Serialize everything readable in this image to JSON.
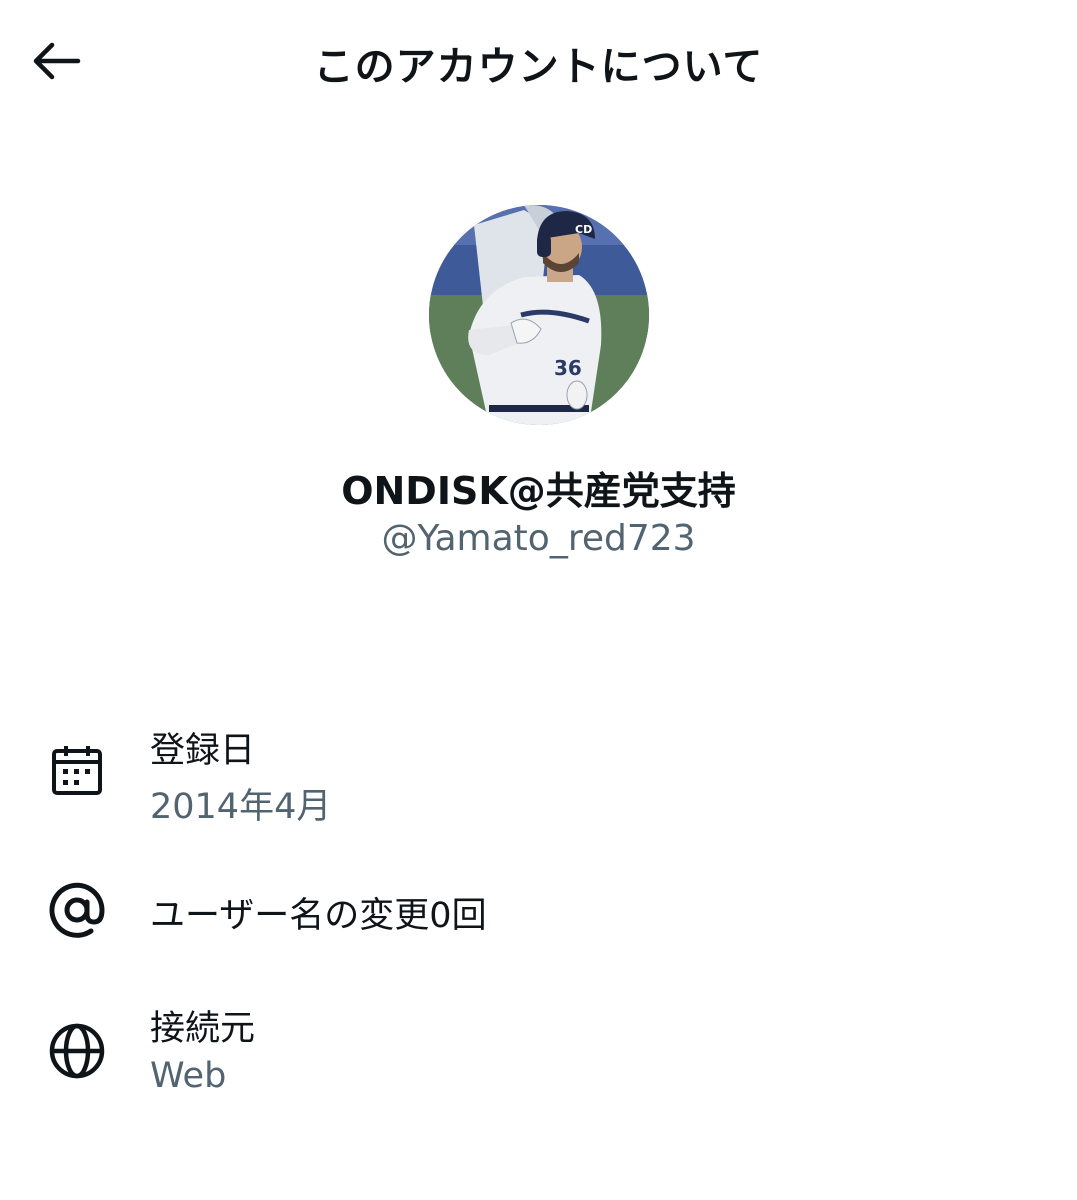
{
  "header": {
    "title": "このアカウントについて",
    "back_icon": "arrow-left-icon"
  },
  "profile": {
    "avatar_icon": "profile-photo",
    "display_name": "ONDISK@共産党支持",
    "handle": "@Yamato_red723"
  },
  "details": {
    "joined": {
      "icon": "calendar-icon",
      "label": "登録日",
      "value": "2014年4月"
    },
    "username_changes": {
      "icon": "at-sign-icon",
      "label": "ユーザー名の変更0回"
    },
    "connected_via": {
      "icon": "globe-icon",
      "label": "接続元",
      "value": "Web"
    }
  },
  "colors": {
    "text": "#0f1419",
    "secondary": "#536471",
    "background": "#ffffff"
  }
}
